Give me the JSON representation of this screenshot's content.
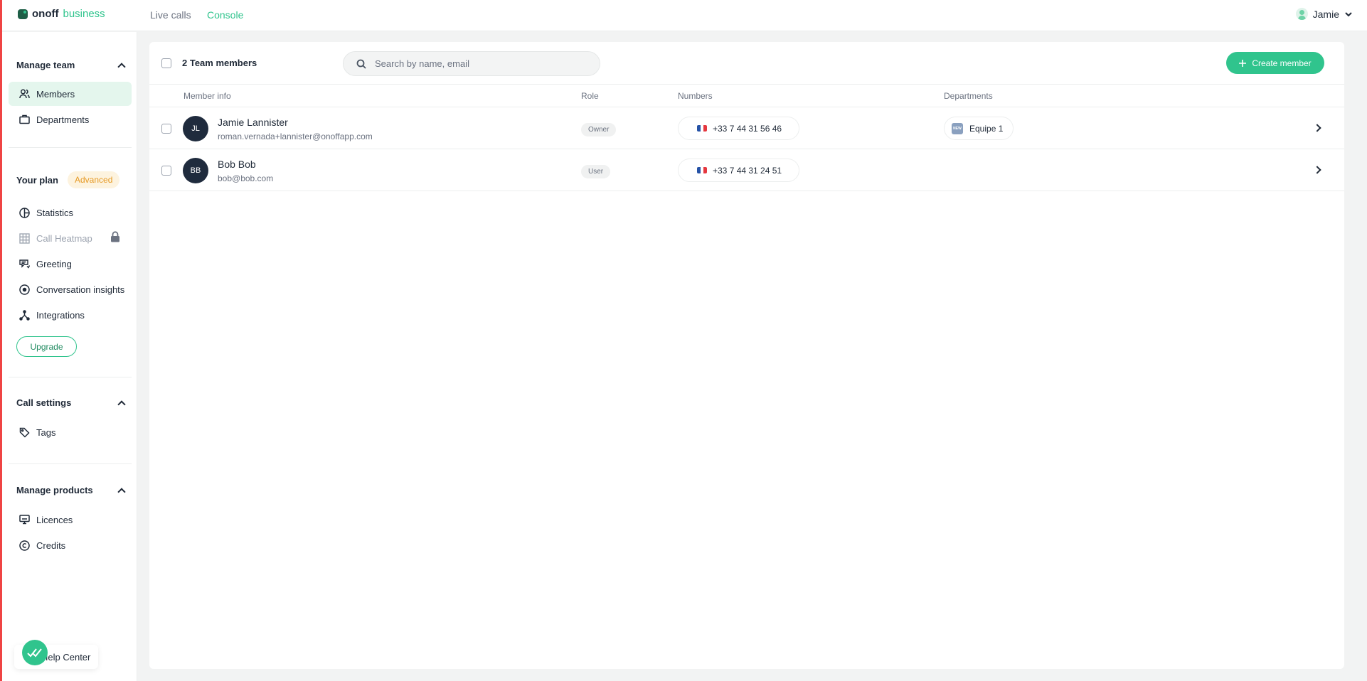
{
  "app": {
    "logo_bold": "onoff",
    "logo_light": "business",
    "nav": {
      "live_calls": "Live calls",
      "console": "Console"
    },
    "user_name": "Jamie",
    "accent_color": "#30c48d"
  },
  "sidebar": {
    "manage_team": {
      "title": "Manage team",
      "items": [
        {
          "label": "Members",
          "icon": "users-icon",
          "active": true
        },
        {
          "label": "Departments",
          "icon": "briefcase-icon"
        }
      ]
    },
    "plan": {
      "title": "Your plan",
      "badge": "Advanced",
      "items": [
        {
          "label": "Statistics",
          "icon": "pie-chart-icon"
        },
        {
          "label": "Call Heatmap",
          "icon": "grid-icon",
          "locked": true
        },
        {
          "label": "Greeting",
          "icon": "greeting-icon"
        },
        {
          "label": "Conversation insights",
          "icon": "target-icon"
        },
        {
          "label": "Integrations",
          "icon": "integrations-icon"
        }
      ],
      "upgrade_label": "Upgrade"
    },
    "call_settings": {
      "title": "Call settings",
      "items": [
        {
          "label": "Tags",
          "icon": "tag-icon"
        }
      ]
    },
    "manage_products": {
      "title": "Manage products",
      "items": [
        {
          "label": "Licences",
          "icon": "licence-icon"
        },
        {
          "label": "Credits",
          "icon": "copyright-icon"
        }
      ]
    },
    "help_center": "Help Center"
  },
  "main": {
    "member_count": "2 Team members",
    "search_placeholder": "Search by name, email",
    "create_button": "Create member",
    "columns": {
      "member_info": "Member info",
      "role": "Role",
      "numbers": "Numbers",
      "departments": "Departments"
    },
    "rows": [
      {
        "initials": "JL",
        "name": "Jamie Lannister",
        "email": "roman.vernada+lannister@onoffapp.com",
        "role": "Owner",
        "number": "+33 7 44 31 56 46",
        "department": "Equipe 1",
        "department_badge": "NEW"
      },
      {
        "initials": "BB",
        "name": "Bob Bob",
        "email": "bob@bob.com",
        "role": "User",
        "number": "+33 7 44 31 24 51",
        "department": ""
      }
    ]
  }
}
